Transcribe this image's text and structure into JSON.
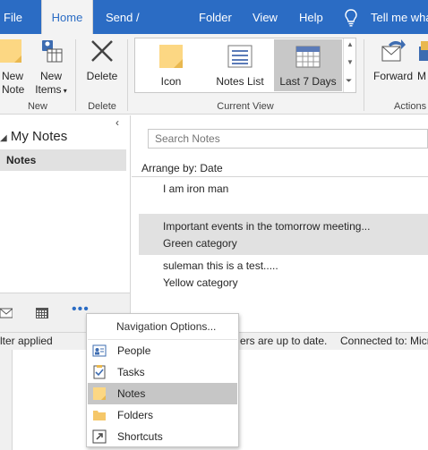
{
  "tabs": [
    {
      "label": "File",
      "active": false
    },
    {
      "label": "Home",
      "active": true
    },
    {
      "label": "Send / Receive",
      "active": false
    },
    {
      "label": "Folder",
      "active": false
    },
    {
      "label": "View",
      "active": false
    },
    {
      "label": "Help",
      "active": false
    }
  ],
  "tell_me": "Tell me wha",
  "ribbon": {
    "new_group": {
      "new_note_line1": "New",
      "new_note_line2": "Note",
      "new_items_line1": "New",
      "new_items_line2": "Items",
      "label": "New"
    },
    "delete_group": {
      "delete": "Delete",
      "label": "Delete"
    },
    "view_group": {
      "icon": "Icon",
      "notes_list": "Notes List",
      "last7": "Last 7 Days",
      "label": "Current View"
    },
    "actions_group": {
      "forward": "Forward",
      "more": "M",
      "label": "Actions"
    }
  },
  "nav": {
    "title": "My Notes",
    "selected_folder": "Notes",
    "collapse": "‹"
  },
  "list": {
    "search_placeholder": "Search Notes",
    "arrange": "Arrange by: Date",
    "notes": [
      {
        "line1": "I am iron man",
        "line2": "",
        "selected": false
      },
      {
        "line1": "Important events in the tomorrow meeting...",
        "line2": "Green category",
        "selected": true
      },
      {
        "line1": "suleman this is  a test.....",
        "line2": "Yellow category",
        "selected": false
      }
    ]
  },
  "status": {
    "filter": "lter applied",
    "updated": "ers are up to date.",
    "connected": "Connected to: Micr"
  },
  "menu": {
    "header": "Navigation Options...",
    "items": [
      {
        "label": "People",
        "icon": "people-icon"
      },
      {
        "label": "Tasks",
        "icon": "tasks-icon"
      },
      {
        "label": "Notes",
        "icon": "notes-icon",
        "selected": true
      },
      {
        "label": "Folders",
        "icon": "folder-icon"
      },
      {
        "label": "Shortcuts",
        "icon": "shortcut-icon"
      }
    ]
  },
  "colors": {
    "accent": "#2b6cc4",
    "note_yellow": "#fcd783",
    "selected_gray": "#c6c6c6"
  }
}
